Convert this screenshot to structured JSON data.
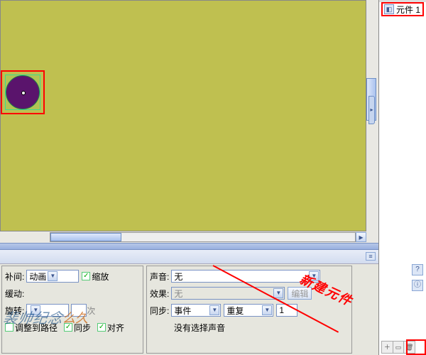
{
  "library": {
    "item_label": "元件 1"
  },
  "props_left": {
    "tween_label": "补间:",
    "tween_value": "动画",
    "scale_label": "缩放",
    "ease_label": "缓动:",
    "rotate_label": "旋转:",
    "rotate_count": "次",
    "orient_label": "调整到路径",
    "sync_label": "同步",
    "snap_label": "对齐"
  },
  "props_right": {
    "sound_label": "声音:",
    "sound_value": "无",
    "effect_label": "效果:",
    "effect_value": "无",
    "edit_btn": "编辑",
    "sync_label": "同步:",
    "sync_value": "事件",
    "repeat_value": "重复",
    "repeat_count": "1",
    "no_sound_msg": "没有选择声音"
  },
  "annotation": {
    "text": "新建元件"
  }
}
